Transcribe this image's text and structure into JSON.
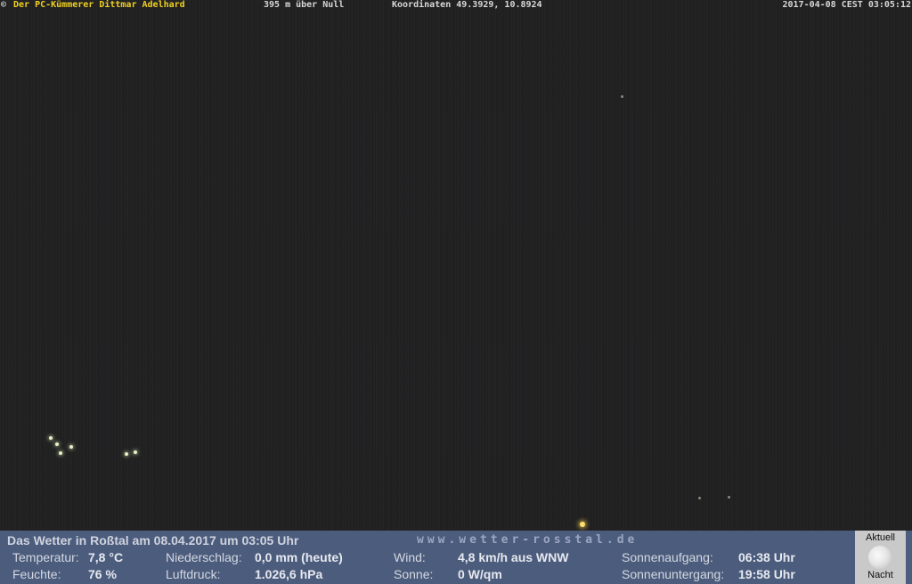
{
  "overlay": {
    "copyright_symbol": "©",
    "owner": "Der PC-Kümmerer Dittmar Adelhard",
    "altitude": "395 m über Null",
    "coordinates": "Koordinaten 49.3929, 10.8924",
    "timestamp": "2017-04-08 CEST 03:05:12"
  },
  "weather_bar": {
    "title": "Das Wetter in Roßtal am 08.04.2017 um 03:05 Uhr",
    "website": "www.wetter-rosstal.de",
    "temperature_label": "Temperatur:",
    "temperature_value": "7,8 °C",
    "humidity_label": "Feuchte:",
    "humidity_value": "76 %",
    "precipitation_label": "Niederschlag:",
    "precipitation_value": "0,0 mm (heute)",
    "pressure_label": "Luftdruck:",
    "pressure_value": "1.026,6 hPa",
    "wind_label": "Wind:",
    "wind_value": "4,8 km/h aus WNW",
    "sun_label": "Sonne:",
    "sun_value": "0 W/qm",
    "sunrise_label": "Sonnenaufgang:",
    "sunrise_value": "06:38 Uhr",
    "sunset_label": "Sonnenuntergang:",
    "sunset_value": "19:58 Uhr"
  },
  "moon_panel": {
    "top_label": "Aktuell",
    "bottom_label": "Nacht",
    "icon": "moon-icon"
  }
}
